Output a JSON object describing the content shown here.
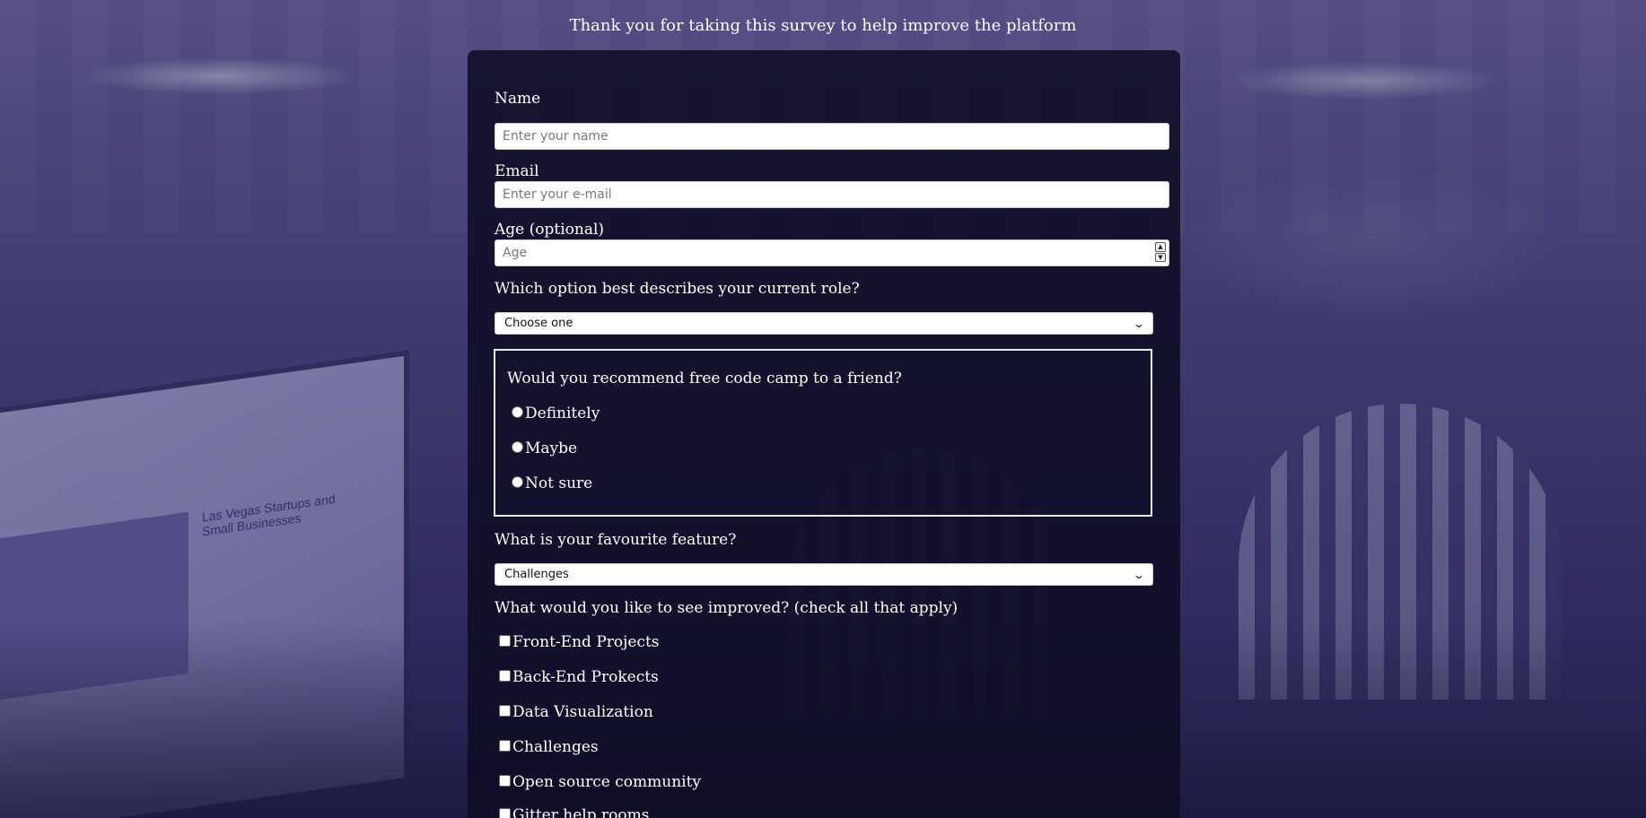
{
  "header": {
    "subtitle": "Thank you for taking this survey to help improve the platform"
  },
  "form": {
    "name": {
      "label": "Name",
      "placeholder": "Enter your name"
    },
    "email": {
      "label": "Email",
      "placeholder": "Enter your e-mail"
    },
    "age": {
      "label": "Age (optional)",
      "placeholder": "Age"
    },
    "role": {
      "question": "Which option best describes your current role?",
      "selected": "Choose one"
    },
    "recommend": {
      "question": "Would you recommend free code camp to a friend?",
      "options": [
        "Definitely",
        "Maybe",
        "Not sure"
      ]
    },
    "feature": {
      "question": "What is your favourite feature?",
      "selected": "Challenges"
    },
    "improve": {
      "question": "What would you like to see improved? (check all that apply)",
      "options": [
        "Front-End Projects",
        "Back-End Prokects",
        "Data Visualization",
        "Challenges",
        "Open source community",
        "Gitter help rooms"
      ]
    }
  },
  "background": {
    "screen_title": "Las Vegas Startups and Small Businesses"
  }
}
